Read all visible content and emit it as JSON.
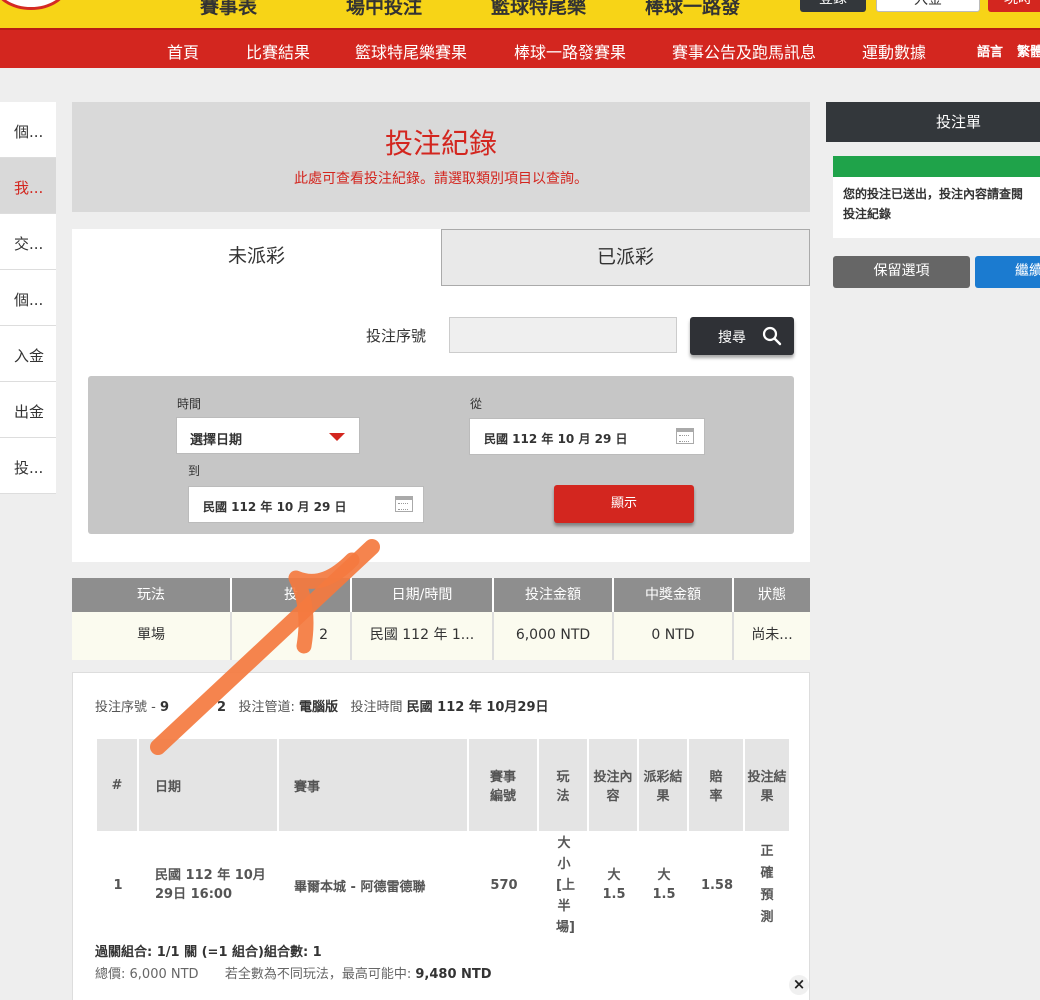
{
  "topbar": {
    "items": [
      "賽事表",
      "場中投注",
      "籃球特尾樂",
      "棒球一路發"
    ],
    "btn_login": "登錄",
    "btn_deposit": "入金",
    "btn_join": "現時"
  },
  "nav": {
    "items": [
      "首頁",
      "比賽結果",
      "籃球特尾樂賽果",
      "棒球一路發賽果",
      "賽事公告及跑馬訊息",
      "運動數據"
    ],
    "lang_label": "語言",
    "lang_value": "繁體"
  },
  "sidebar": {
    "items": [
      "個...",
      "我...",
      "交...",
      "個...",
      "入金",
      "出金",
      "投..."
    ]
  },
  "header": {
    "title": "投注紀錄",
    "subtitle": "此處可查看投注紀錄。請選取類別項目以查詢。"
  },
  "tabs": {
    "unsettled": "未派彩",
    "settled": "已派彩"
  },
  "search": {
    "serial_label": "投注序號",
    "serial_value": "",
    "search_button": "搜尋"
  },
  "filter": {
    "time_label": "時間",
    "time_select": "選擇日期",
    "from_label": "從",
    "from_date": "民國 112 年 10 月 29 日",
    "to_label": "到",
    "to_date": "民國 112 年 10 月 29 日",
    "show_button": "顯示"
  },
  "summary": {
    "headers": [
      "玩法",
      "投",
      "日期/時間",
      "投注金額",
      "中獎金額",
      "狀態"
    ],
    "row": [
      "單場",
      "2",
      "民國 112 年 1...",
      "6,000 NTD",
      "0 NTD",
      "尚未..."
    ]
  },
  "detail": {
    "serial_label": "投注序號",
    "serial_value": "9",
    "serial_tail": "2",
    "channel_label": "投注管道:",
    "channel_value": "電腦版",
    "time_label": "投注時間",
    "time_value": "民國 112 年 10月29日",
    "headers": {
      "num": "#",
      "date": "日期",
      "event": "賽事",
      "event_no": "賽事編號",
      "play": "玩法",
      "bet_content": "投注內容",
      "payout_result": "派彩結果",
      "odds": "賠率",
      "bet_result": "投注結果"
    },
    "row": {
      "num": "1",
      "date": "民國 112 年 10月29日 16:00",
      "event": "畢爾本城 - 阿德雷德聯",
      "event_no": "570",
      "play": "大小[上半場]",
      "bet_content_a": "大",
      "bet_content_b": "1.5",
      "payout_a": "大",
      "payout_b": "1.5",
      "odds": "1.58",
      "bet_result": "正確預測"
    },
    "combo": "過關組合: 1/1 關 (=1 組合)組合數: 1",
    "total_label": "總價:",
    "total_value": "6,000 NTD",
    "max_win_label": "若全數為不同玩法，最高可能中:",
    "max_win_value": "9,480 NTD",
    "close": "×"
  },
  "slip": {
    "title": "投注單",
    "message_line1": "您的投注已送出，投注內容請查閱",
    "message_line2": "投注紀錄",
    "keep_button": "保留選項",
    "continue_button": "繼續"
  },
  "colors": {
    "brand_red": "#d3261f",
    "brand_yellow": "#f7d417",
    "success_green": "#1fa34a",
    "continue_blue": "#1b7bd0",
    "annotation_orange": "#f47a3f"
  }
}
